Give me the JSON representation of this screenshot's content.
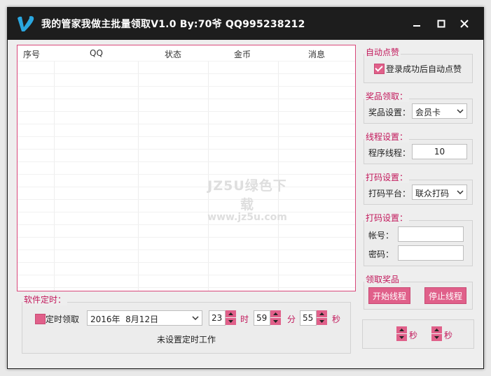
{
  "titlebar": {
    "title": "我的管家我做主批量领取V1.0 By:70爷 QQ995238212",
    "icons": [
      "logo-v-icon",
      "minimize-icon",
      "maximize-icon",
      "close-icon"
    ]
  },
  "grid": {
    "columns": [
      "序号",
      "QQ",
      "状态",
      "金币",
      "消息"
    ],
    "rows": []
  },
  "watermark": {
    "line1": "JZ5U绿色下载",
    "line2": "www.jz5u.com"
  },
  "auto_like": {
    "label": "自动点赞",
    "checkbox_label": "登录成功后自动点赞",
    "checked": true
  },
  "prize": {
    "label": "奖品领取：",
    "field_label": "奖品设置：",
    "selected": "会员卡"
  },
  "thread": {
    "label": "线程设置：",
    "field_label": "程序线程：",
    "value": "10"
  },
  "captcha_platform": {
    "label": "打码设置：",
    "field_label": "打码平台：",
    "selected": "联众打码"
  },
  "captcha_account": {
    "label": "打码设置：",
    "account_label": "帐号：",
    "account_value": "",
    "password_label": "密码：",
    "password_value": ""
  },
  "claim": {
    "label": "领取奖品",
    "start_button": "开始线程",
    "stop_button": "停止线程"
  },
  "delay": {
    "unit1": "秒",
    "unit2": "秒"
  },
  "timer": {
    "label": "软件定时：",
    "checkbox_label": "定时领取",
    "checked": false,
    "date": "2016年  8月12日",
    "hour": "23",
    "hour_unit": "时",
    "minute": "59",
    "minute_unit": "分",
    "second": "55",
    "second_unit": "秒",
    "status": "未设置定时工作"
  },
  "colors": {
    "accent": "#e0608a",
    "label_text": "#c2185b",
    "titlebar": "#1d1d1d"
  }
}
